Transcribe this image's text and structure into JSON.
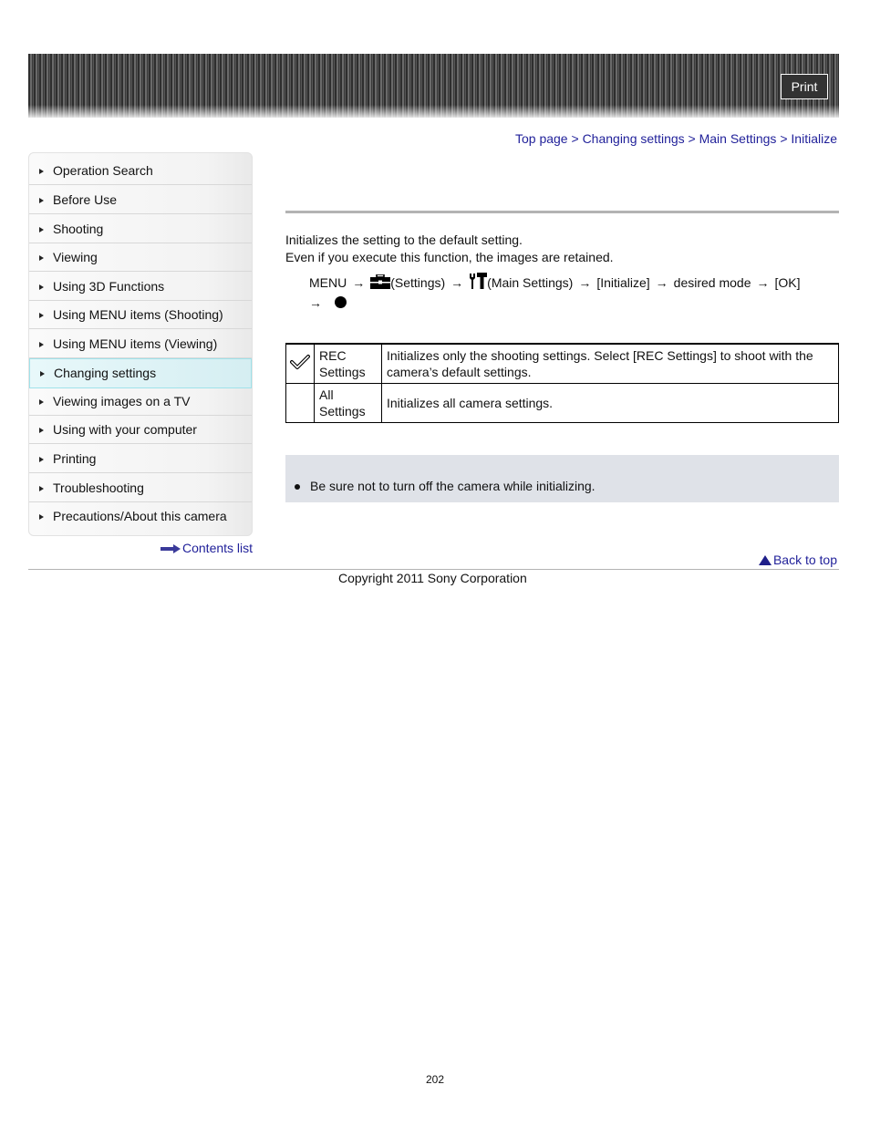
{
  "header": {
    "print_label": "Print"
  },
  "breadcrumb": {
    "items": [
      "Top page",
      "Changing settings",
      "Main Settings",
      "Initialize"
    ],
    "separator": ">"
  },
  "sidebar": {
    "items": [
      {
        "label": "Operation Search",
        "active": false
      },
      {
        "label": "Before Use",
        "active": false
      },
      {
        "label": "Shooting",
        "active": false
      },
      {
        "label": "Viewing",
        "active": false
      },
      {
        "label": "Using 3D Functions",
        "active": false
      },
      {
        "label": "Using MENU items (Shooting)",
        "active": false
      },
      {
        "label": "Using MENU items (Viewing)",
        "active": false
      },
      {
        "label": "Changing settings",
        "active": true
      },
      {
        "label": "Viewing images on a TV",
        "active": false
      },
      {
        "label": "Using with your computer",
        "active": false
      },
      {
        "label": "Printing",
        "active": false
      },
      {
        "label": "Troubleshooting",
        "active": false
      },
      {
        "label": "Precautions/About this camera",
        "active": false
      }
    ],
    "contents_link": "Contents list"
  },
  "main": {
    "intro_lines": [
      "Initializes the setting to the default setting.",
      "Even if you execute this function, the images are retained."
    ],
    "menu_path": {
      "menu": "MENU",
      "arrow": "→",
      "settings_icon": "toolbox-icon",
      "settings": "(Settings)",
      "main_settings_icon": "tools-icon",
      "main_settings": "(Main Settings)",
      "initialize": "[Initialize]",
      "desired_mode": "desired mode",
      "ok": "[OK]",
      "final_icon": "center-button-icon"
    },
    "modes": [
      {
        "icon": "checkmark-icon",
        "default": true,
        "name_line1": "REC",
        "name_line2": "Settings",
        "description": "Initializes only the shooting settings. Select [REC Settings] to shoot with the camera’s default settings."
      },
      {
        "icon": "",
        "default": false,
        "name_line1": "All",
        "name_line2": "Settings",
        "description": "Initializes all camera settings."
      }
    ],
    "notes": [
      "Be sure not to turn off the camera while initializing."
    ]
  },
  "footer": {
    "back_to_top": "Back to top",
    "copyright": "Copyright 2011 Sony Corporation",
    "page_number": "202"
  }
}
